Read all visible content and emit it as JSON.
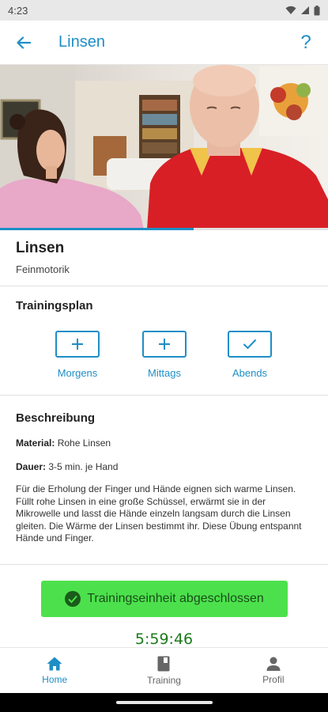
{
  "status_bar": {
    "time": "4:23"
  },
  "app_bar": {
    "title": "Linsen",
    "help_label": "?"
  },
  "video": {
    "progress": 0.59
  },
  "exercise": {
    "title": "Linsen",
    "category": "Feinmotorik"
  },
  "training_plan": {
    "heading": "Trainingsplan",
    "slots": [
      {
        "label": "Morgens",
        "state": "add"
      },
      {
        "label": "Mittags",
        "state": "add"
      },
      {
        "label": "Abends",
        "state": "done"
      }
    ]
  },
  "description": {
    "heading": "Beschreibung",
    "material_label": "Material:",
    "material_value": "Rohe Linsen",
    "duration_label": "Dauer:",
    "duration_value": "3-5 min. je Hand",
    "text": "Für die Erholung der Finger und Hände eignen sich warme Linsen. Füllt rohe Linsen in eine große Schüssel, erwärmt sie in der Mikrowelle und lasst die Hände einzeln langsam durch die Linsen gleiten. Die Wärme der Linsen bestimmt ihr. Diese Übung entspannt Hände und Finger."
  },
  "completion": {
    "button_label": "Trainingseinheit abgeschlossen",
    "timer": "5:59:46"
  },
  "bottom_nav": {
    "items": [
      {
        "label": "Home",
        "icon": "home-icon",
        "active": true
      },
      {
        "label": "Training",
        "icon": "book-icon",
        "active": false
      },
      {
        "label": "Profil",
        "icon": "person-icon",
        "active": false
      }
    ]
  },
  "colors": {
    "accent": "#1e8ec6",
    "success": "#4ce14c",
    "timer": "#1c7a1c"
  }
}
